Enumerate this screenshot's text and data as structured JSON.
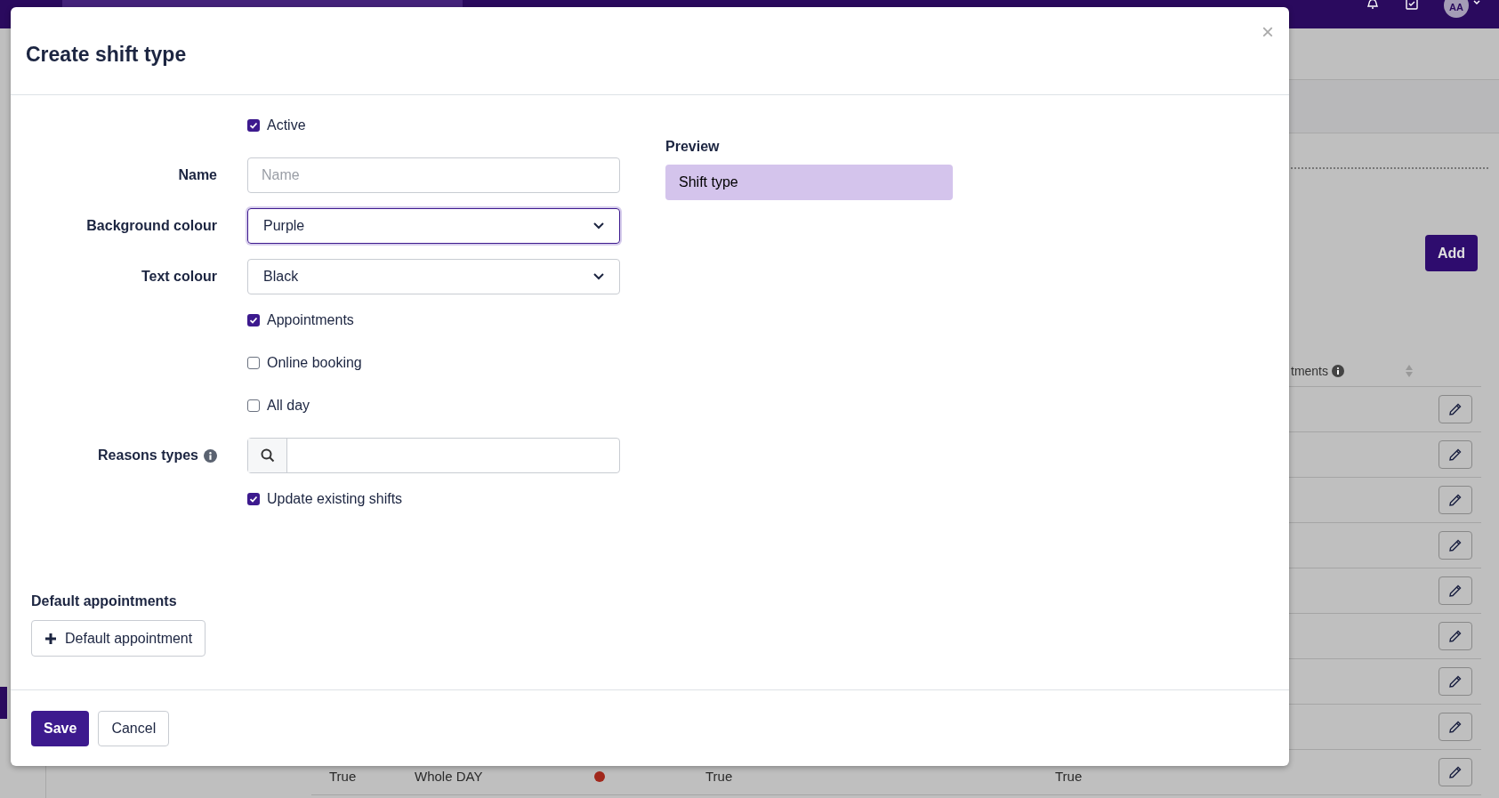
{
  "top_bar": {
    "avatar": "AA"
  },
  "page": {
    "add_button": "Add",
    "table": {
      "column_header": "tments",
      "rows": [
        {
          "edit": true
        },
        {
          "edit": true
        },
        {
          "edit": true
        },
        {
          "edit": true
        },
        {
          "edit": true
        },
        {
          "edit": true
        },
        {
          "edit": true
        },
        {
          "edit": true
        },
        {
          "edit": true,
          "cells": [
            "True",
            "Whole DAY",
            "True",
            "True"
          ],
          "color": "#a1281c"
        }
      ]
    }
  },
  "dialog": {
    "title": "Create shift type",
    "close": "×",
    "fields": [
      {
        "kind": "checkbox",
        "label": "Active",
        "checked": true
      },
      {
        "kind": "text",
        "label": "Name",
        "placeholder": "Name"
      },
      {
        "kind": "select",
        "label": "Background colour",
        "value": "Purple",
        "focused": true
      },
      {
        "kind": "select",
        "label": "Text colour",
        "value": "Black",
        "focused": false
      },
      {
        "kind": "checkbox",
        "label": "Appointments",
        "checked": true
      },
      {
        "kind": "checkbox",
        "label": "Online booking",
        "checked": false
      },
      {
        "kind": "checkbox",
        "label": "All day",
        "checked": false
      },
      {
        "kind": "search",
        "label": "Reasons types",
        "info": true
      },
      {
        "kind": "checkbox",
        "label": "Update existing shifts",
        "checked": true
      }
    ],
    "preview": {
      "label": "Preview",
      "sample": "Shift type"
    },
    "default_appointments": {
      "label": "Default appointments",
      "button": "Default appointment"
    },
    "footer": {
      "save": "Save",
      "cancel": "Cancel"
    }
  }
}
